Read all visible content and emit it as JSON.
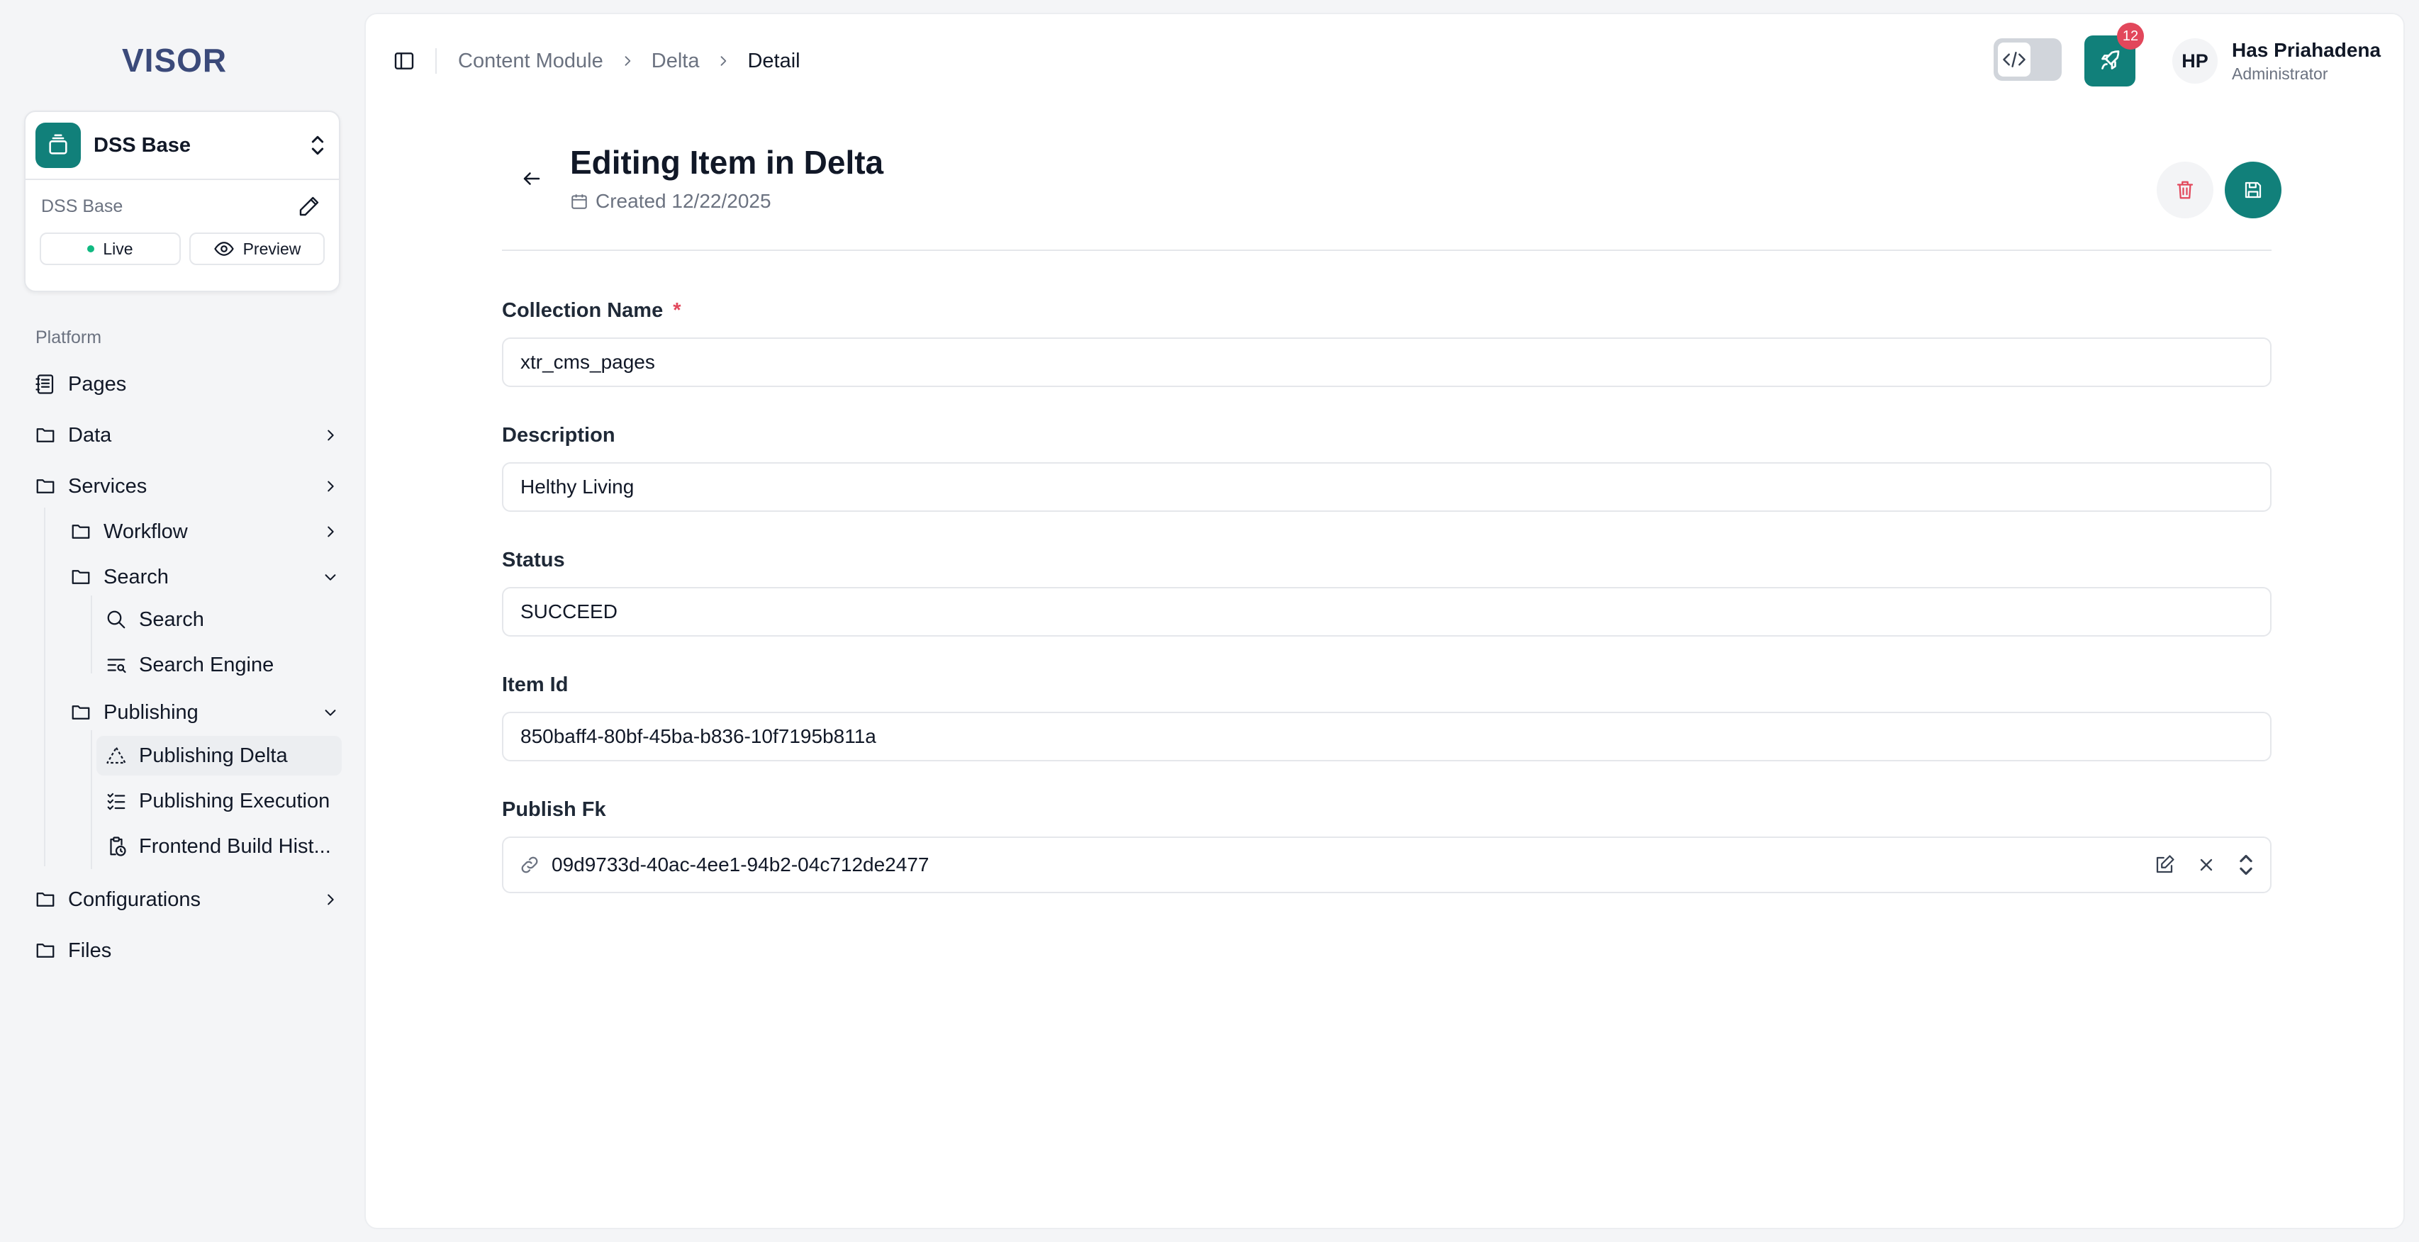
{
  "app": {
    "logo_text": "VISOR"
  },
  "site": {
    "name": "DSS Base",
    "sub_label": "DSS Base",
    "live_label": "Live",
    "preview_label": "Preview"
  },
  "sidebar": {
    "section_label": "Platform",
    "items": {
      "pages": "Pages",
      "data": "Data",
      "services": "Services",
      "workflow": "Workflow",
      "search_group": "Search",
      "search": "Search",
      "search_engine": "Search Engine",
      "publishing": "Publishing",
      "publishing_delta": "Publishing Delta",
      "publishing_execution": "Publishing Execution",
      "frontend_build_history": "Frontend Build Hist...",
      "configurations": "Configurations",
      "files": "Files"
    },
    "active_item": "Publishing Delta"
  },
  "header": {
    "breadcrumb": [
      "Content Module",
      "Delta",
      "Detail"
    ],
    "notification_count": "12",
    "user": {
      "initials": "HP",
      "name": "Has Priahadena",
      "role": "Administrator"
    }
  },
  "page": {
    "title": "Editing Item in Delta",
    "created": "Created 12/22/2025"
  },
  "form": {
    "collection_name": {
      "label": "Collection Name",
      "required_mark": "*",
      "value": "xtr_cms_pages"
    },
    "description": {
      "label": "Description",
      "value": "Helthy Living"
    },
    "status": {
      "label": "Status",
      "value": "SUCCEED"
    },
    "item_id": {
      "label": "Item Id",
      "value": "850baff4-80bf-45ba-b836-10f7195b811a"
    },
    "publish_fk": {
      "label": "Publish Fk",
      "value": "09d9733d-40ac-4ee1-94b2-04c712de2477"
    }
  },
  "colors": {
    "accent": "#11807a",
    "danger": "#e2475b",
    "logo": "#3b4a7a"
  }
}
